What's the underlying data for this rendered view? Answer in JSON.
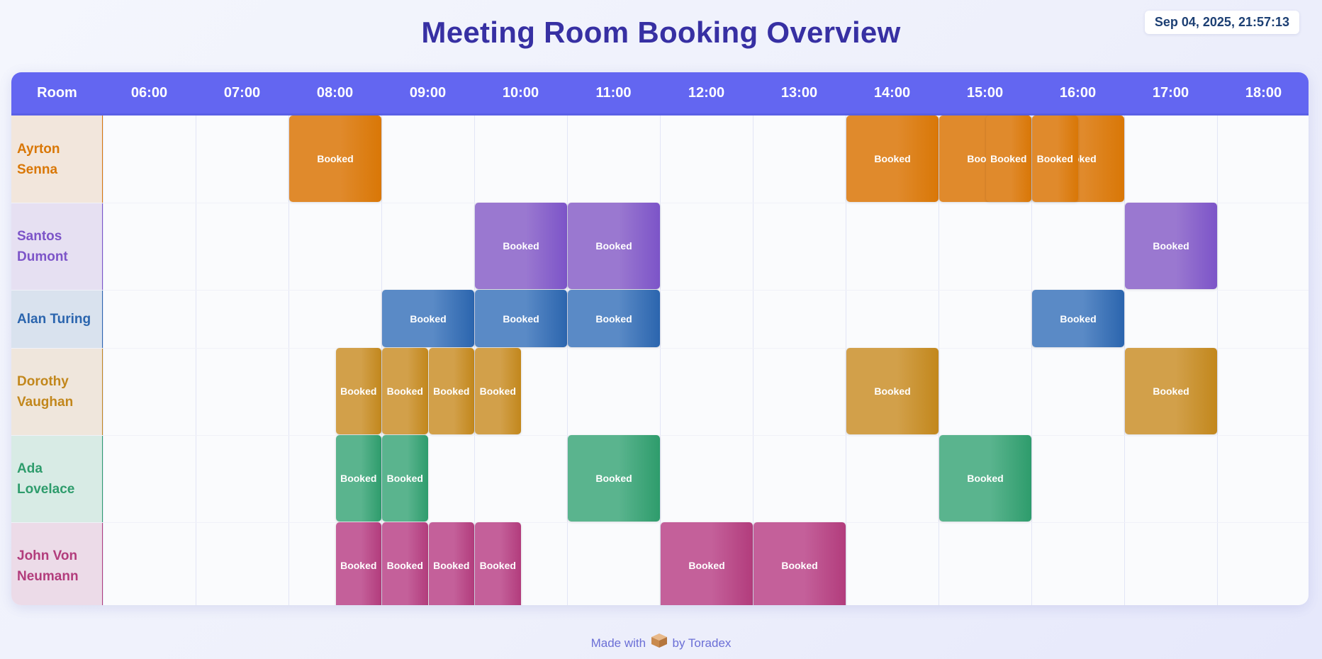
{
  "title": "Meeting Room Booking Overview",
  "datetime": "Sep 04, 2025, 21:57:13",
  "header": {
    "room_label": "Room",
    "hours": [
      "06:00",
      "07:00",
      "08:00",
      "09:00",
      "10:00",
      "11:00",
      "12:00",
      "13:00",
      "14:00",
      "15:00",
      "16:00",
      "17:00",
      "18:00"
    ]
  },
  "rooms": [
    {
      "name": "Ayrton Senna",
      "text_color": "#d97706",
      "bg_color": "#f2e6dc",
      "booking_color": "#e08a2c",
      "booking_color_dark": "#d97706",
      "bookings": [
        {
          "start": 8.0,
          "end": 9.0,
          "label": "Booked"
        },
        {
          "start": 14.0,
          "end": 15.0,
          "label": "Booked"
        },
        {
          "start": 15.0,
          "end": 16.0,
          "label": "Booked"
        },
        {
          "start": 16.0,
          "end": 17.0,
          "label": "Booked"
        },
        {
          "start": 15.5,
          "end": 16.0,
          "label": "Booked"
        },
        {
          "start": 16.0,
          "end": 16.5,
          "label": "Booked"
        }
      ]
    },
    {
      "name": "Santos Dumont",
      "text_color": "#7c54c8",
      "bg_color": "#e6e0f2",
      "booking_color": "#9a78d0",
      "booking_color_dark": "#7c54c8",
      "bookings": [
        {
          "start": 10.0,
          "end": 11.0,
          "label": "Booked"
        },
        {
          "start": 11.0,
          "end": 12.0,
          "label": "Booked"
        },
        {
          "start": 17.0,
          "end": 18.0,
          "label": "Booked"
        }
      ]
    },
    {
      "name": "Alan Turing",
      "text_color": "#2b65ae",
      "bg_color": "#d9e2ee",
      "booking_color": "#5a8ac6",
      "booking_color_dark": "#2b65ae",
      "bookings": [
        {
          "start": 9.0,
          "end": 10.0,
          "label": "Booked"
        },
        {
          "start": 10.0,
          "end": 11.0,
          "label": "Booked"
        },
        {
          "start": 11.0,
          "end": 12.0,
          "label": "Booked"
        },
        {
          "start": 16.0,
          "end": 17.0,
          "label": "Booked"
        }
      ]
    },
    {
      "name": "Dorothy Vaughan",
      "text_color": "#c2871c",
      "bg_color": "#efe6dc",
      "booking_color": "#d2a04a",
      "booking_color_dark": "#c2871c",
      "bookings": [
        {
          "start": 8.5,
          "end": 9.0,
          "label": "Booked"
        },
        {
          "start": 9.0,
          "end": 9.5,
          "label": "Booked"
        },
        {
          "start": 9.5,
          "end": 10.0,
          "label": "Booked"
        },
        {
          "start": 10.0,
          "end": 10.5,
          "label": "Booked"
        },
        {
          "start": 14.0,
          "end": 15.0,
          "label": "Booked"
        },
        {
          "start": 17.0,
          "end": 18.0,
          "label": "Booked"
        }
      ]
    },
    {
      "name": "Ada Lovelace",
      "text_color": "#2e9c6c",
      "bg_color": "#d8ebe5",
      "booking_color": "#5ab48e",
      "booking_color_dark": "#2e9c6c",
      "bookings": [
        {
          "start": 8.5,
          "end": 9.0,
          "label": "Booked"
        },
        {
          "start": 9.0,
          "end": 9.5,
          "label": "Booked"
        },
        {
          "start": 11.0,
          "end": 12.0,
          "label": "Booked"
        },
        {
          "start": 15.0,
          "end": 16.0,
          "label": "Booked"
        }
      ]
    },
    {
      "name": "John Von Neumann",
      "text_color": "#b23c7c",
      "bg_color": "#ecdbe8",
      "booking_color": "#c4609a",
      "booking_color_dark": "#b23c7c",
      "bookings": [
        {
          "start": 8.5,
          "end": 9.0,
          "label": "Booked"
        },
        {
          "start": 9.0,
          "end": 9.5,
          "label": "Booked"
        },
        {
          "start": 9.5,
          "end": 10.0,
          "label": "Booked"
        },
        {
          "start": 10.0,
          "end": 10.5,
          "label": "Booked"
        },
        {
          "start": 12.0,
          "end": 13.0,
          "label": "Booked"
        },
        {
          "start": 13.0,
          "end": 14.0,
          "label": "Booked"
        }
      ]
    }
  ],
  "footer": {
    "prefix": "Made with",
    "icon": "box-icon",
    "suffix": "by Toradex"
  }
}
